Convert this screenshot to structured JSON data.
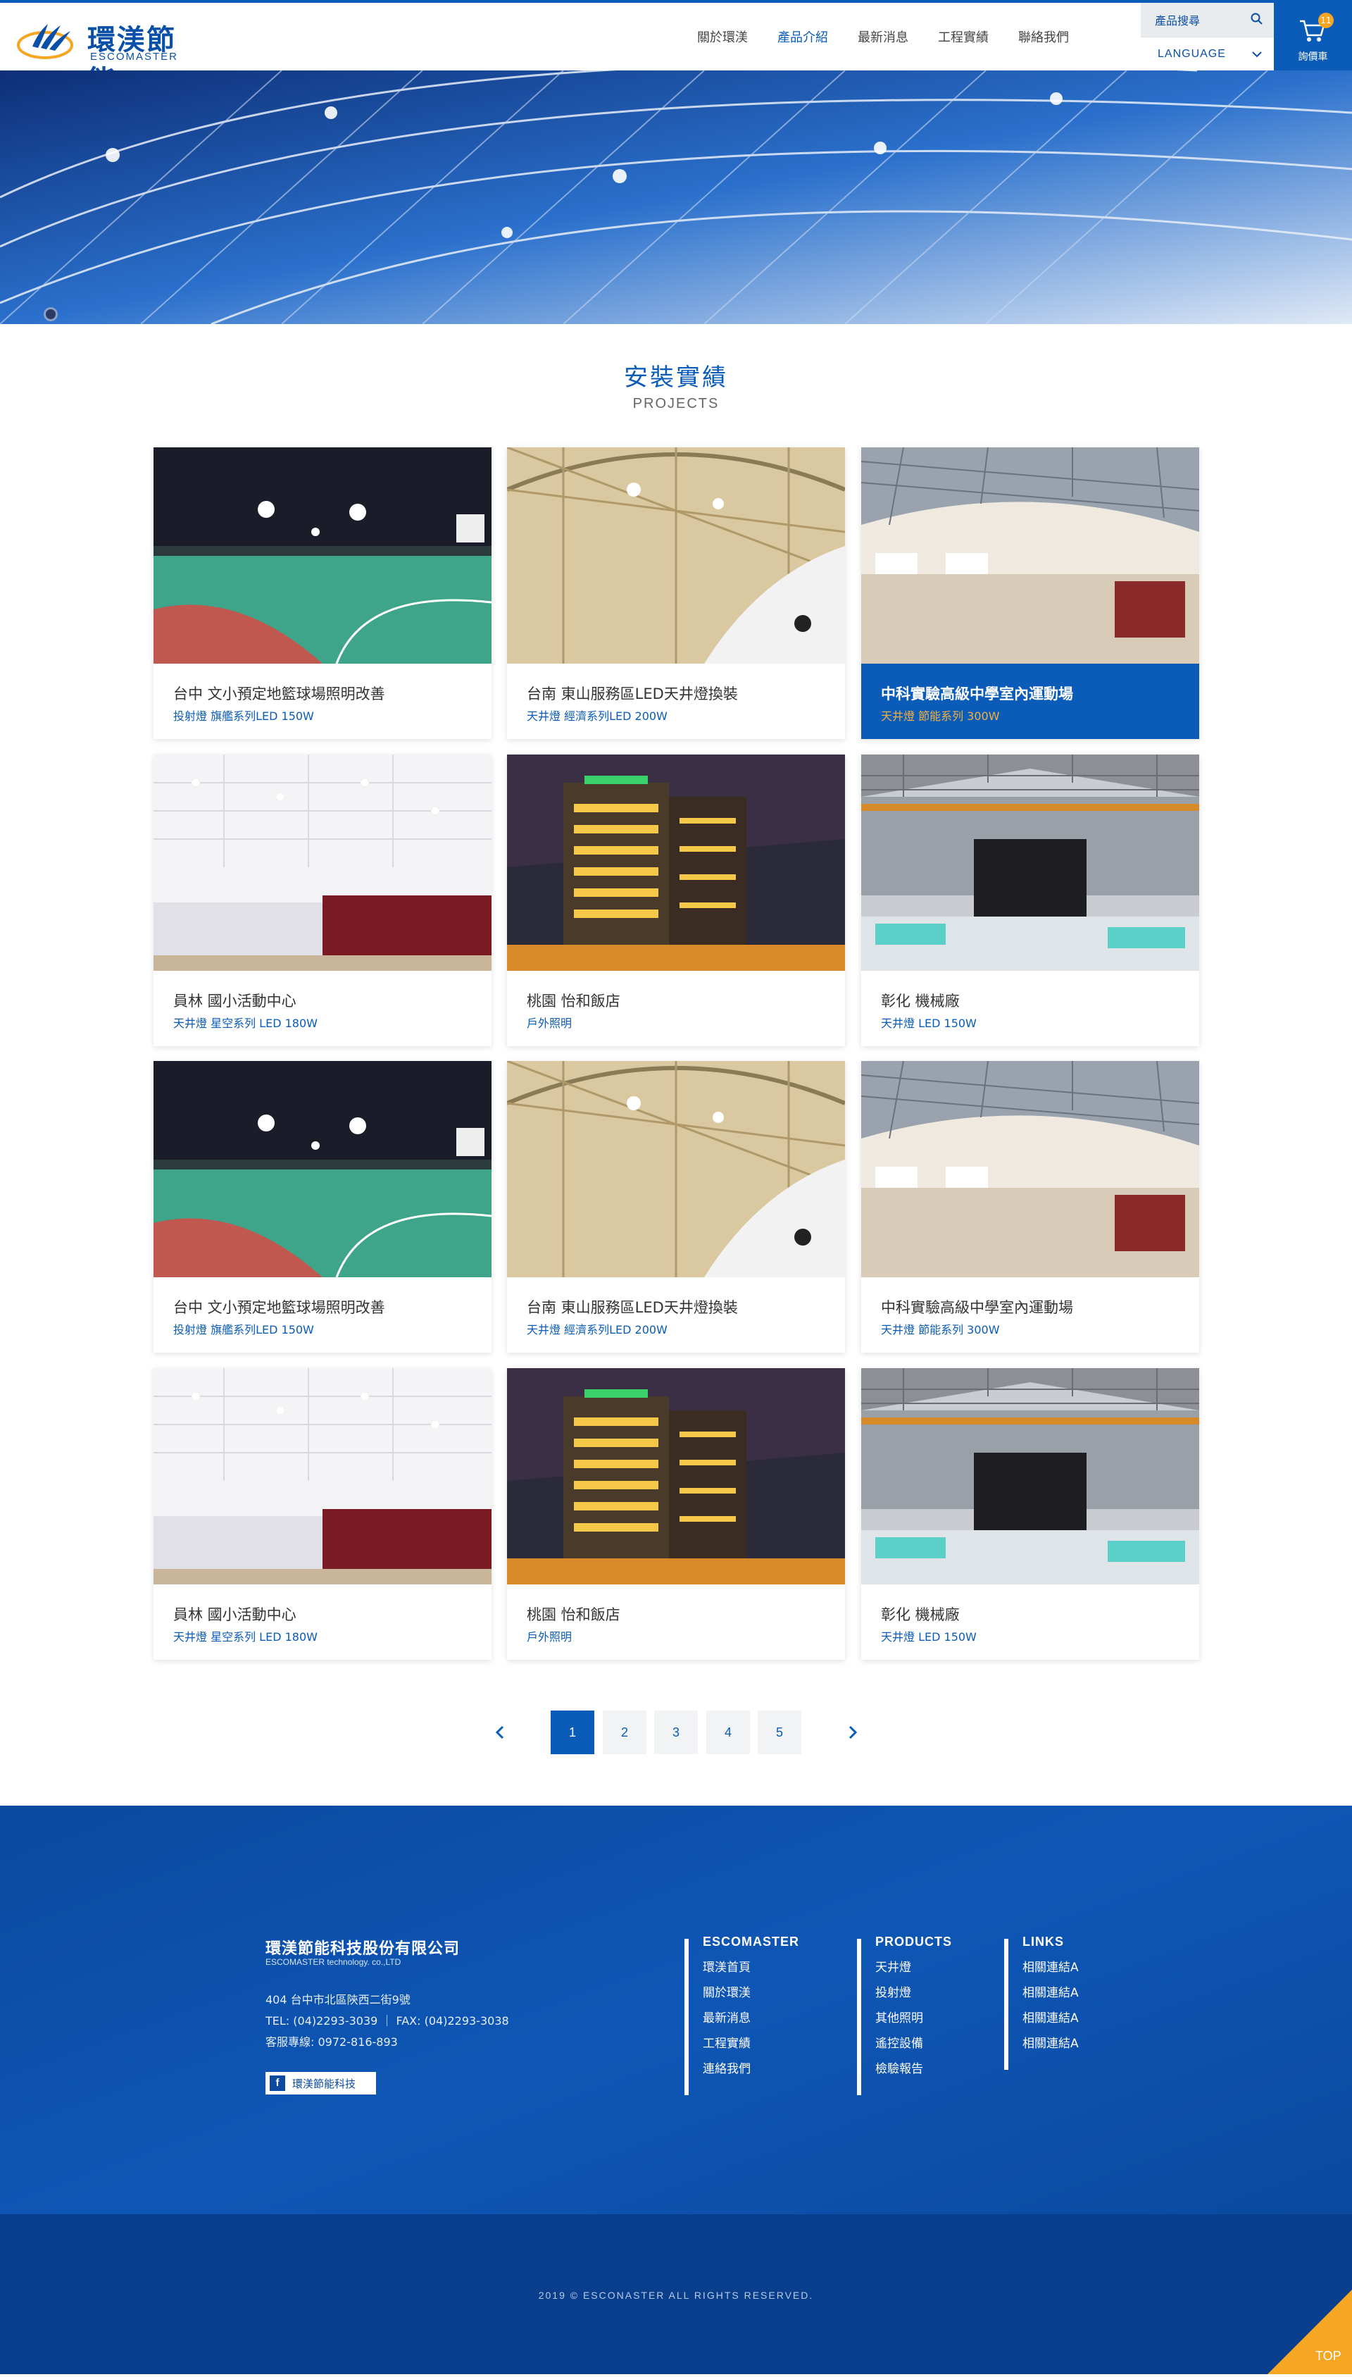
{
  "header": {
    "logo_cn": "環渼節能",
    "logo_en": "ESCOMASTER",
    "nav": [
      {
        "label": "關於環渼",
        "active": false
      },
      {
        "label": "產品介紹",
        "active": true
      },
      {
        "label": "最新消息",
        "active": false
      },
      {
        "label": "工程實績",
        "active": false
      },
      {
        "label": "聯絡我們",
        "active": false
      }
    ],
    "search_label": "產品搜尋",
    "language_label": "LANGUAGE",
    "cart_label": "詢價車",
    "cart_count": "11"
  },
  "section": {
    "title": "安裝實績",
    "subtitle": "PROJECTS"
  },
  "projects": [
    {
      "title": "台中 文小預定地籃球場照明改善",
      "tag": "投射燈 旗艦系列LED 150W",
      "scene": "court"
    },
    {
      "title": "台南 東山服務區LED天井燈換裝",
      "tag": "天井燈 經濟系列LED 200W",
      "scene": "dome"
    },
    {
      "title": "中科實驗高級中學室內運動場",
      "tag": "天井燈 節能系列 300W",
      "scene": "gym",
      "active": true
    },
    {
      "title": "員林 國小活動中心",
      "tag": "天井燈 星空系列 LED 180W",
      "scene": "hall"
    },
    {
      "title": "桃園 怡和飯店",
      "tag": "戶外照明",
      "scene": "hotel"
    },
    {
      "title": "彰化 機械廠",
      "tag": "天井燈 LED 150W",
      "scene": "factory"
    },
    {
      "title": "台中 文小預定地籃球場照明改善",
      "tag": "投射燈 旗艦系列LED 150W",
      "scene": "court"
    },
    {
      "title": "台南 東山服務區LED天井燈換裝",
      "tag": "天井燈 經濟系列LED 200W",
      "scene": "dome"
    },
    {
      "title": "中科實驗高級中學室內運動場",
      "tag": "天井燈 節能系列 300W",
      "scene": "gym"
    },
    {
      "title": "員林 國小活動中心",
      "tag": "天井燈 星空系列 LED 180W",
      "scene": "hall"
    },
    {
      "title": "桃園 怡和飯店",
      "tag": "戶外照明",
      "scene": "hotel"
    },
    {
      "title": "彰化 機械廠",
      "tag": "天井燈 LED 150W",
      "scene": "factory"
    }
  ],
  "pagination": {
    "pages": [
      "1",
      "2",
      "3",
      "4",
      "5"
    ],
    "current": "1"
  },
  "footer": {
    "company_cn": "環渼節能科技股份有限公司",
    "company_en": "ESCOMASTER technology. co.,LTD",
    "address": "404 台中市北區陝西二街9號",
    "tel_fax": "TEL: (04)2293-3039 ｜ FAX: (04)2293-3038",
    "hotline": "客服專線: 0972-816-893",
    "facebook_label": "環渼節能科技",
    "columns": [
      {
        "heading": "ESCOMASTER",
        "links": [
          "環渼首頁",
          "關於環渼",
          "最新消息",
          "工程實績",
          "連絡我們"
        ]
      },
      {
        "heading": "PRODUCTS",
        "links": [
          "天井燈",
          "投射燈",
          "其他照明",
          "遙控設備",
          "檢驗報告"
        ]
      },
      {
        "heading": "LINKS",
        "links": [
          "相關連結A",
          "相關連結A",
          "相關連結A",
          "相關連結A"
        ]
      }
    ],
    "copyright": "2019 © ESCONASTER ALL RIGHTS RESERVED.",
    "top_label": "TOP"
  },
  "colors": {
    "brand_blue": "#0a5cb8",
    "accent_orange": "#f5a623"
  }
}
